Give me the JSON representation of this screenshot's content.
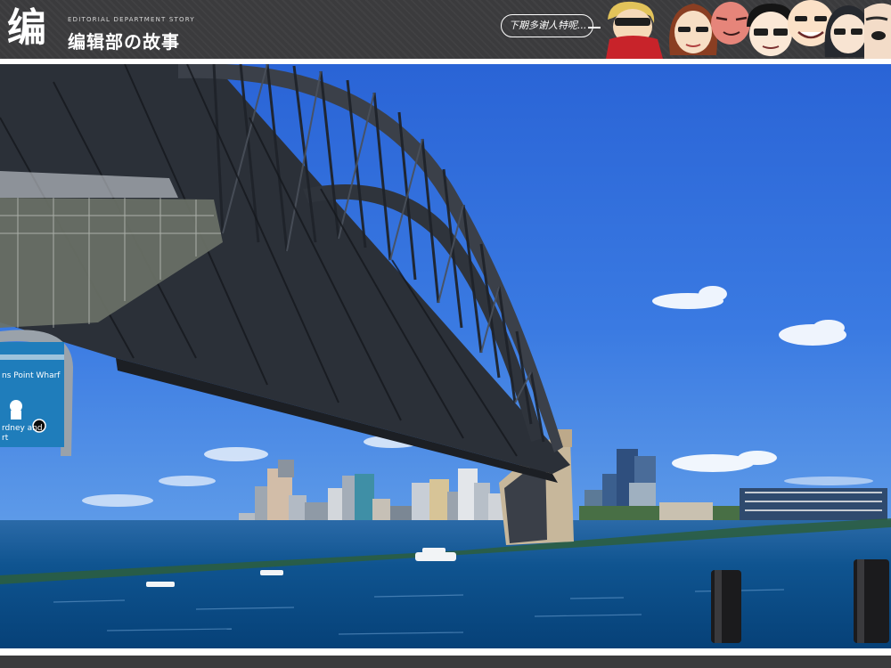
{
  "banner": {
    "logo_glyph": "编",
    "subtitle": "EDITORIAL DEPARTMENT STORY",
    "title": "编辑部の故事",
    "speech": "下期多谢人特呢..."
  },
  "photo": {
    "sign_line1": "ns Point Wharf",
    "sign_line2": "rdney and",
    "sign_line3": "rt"
  },
  "icons": {
    "cartoon_faces": [
      "blonde-scarf-face",
      "brown-hair-face",
      "red-face",
      "glasses-man-face",
      "bald-man-face",
      "long-hair-glasses-face",
      "partial-face"
    ]
  },
  "colors": {
    "banner": "#3b3b3d",
    "sky": "#2f6fdc",
    "water": "#0d4f86",
    "bridge_steel": "#3a3f48"
  }
}
